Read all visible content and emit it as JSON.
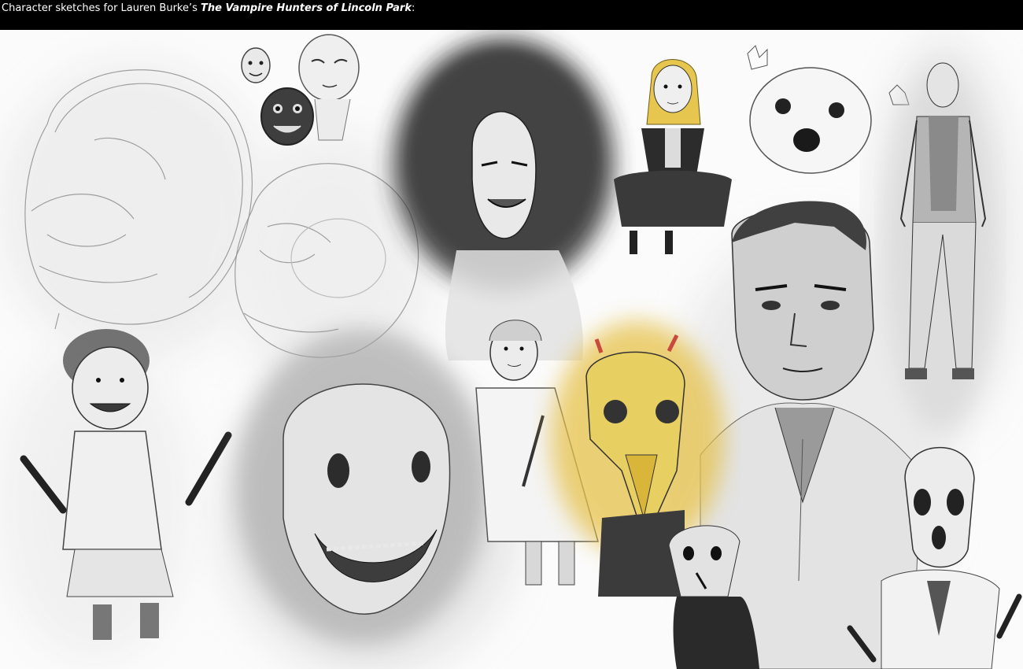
{
  "caption": {
    "prefix": "Character sketches for Lauren Burke’s ",
    "book_title": "The Vampire Hunters of Lincoln Park",
    "suffix": ":"
  },
  "colors": {
    "caption_bg": "#000000",
    "caption_text": "#ffffff",
    "paper": "#ffffff",
    "graphite": "#3a3a3a",
    "smudge": "#c9c9c9",
    "ochre": "#e0b21e",
    "red_horn": "#c84a3c"
  }
}
